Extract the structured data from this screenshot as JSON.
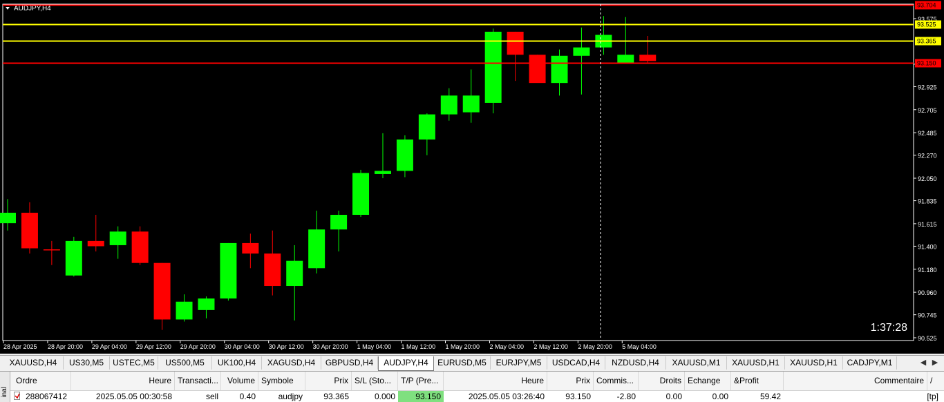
{
  "chart": {
    "symbol_label": "AUDJPY,H4",
    "countdown": "1:37:28",
    "price_axis": [
      "93.575",
      "93.140",
      "92.925",
      "92.705",
      "92.485",
      "92.270",
      "92.050",
      "91.835",
      "91.615",
      "91.400",
      "91.180",
      "90.960",
      "90.745",
      "90.525"
    ],
    "time_axis": [
      "28 Apr 2025",
      "28 Apr 20:00",
      "29 Apr 04:00",
      "29 Apr 12:00",
      "29 Apr 20:00",
      "30 Apr 04:00",
      "30 Apr 12:00",
      "30 Apr 20:00",
      "1 May 04:00",
      "1 May 12:00",
      "1 May 20:00",
      "2 May 04:00",
      "2 May 12:00",
      "2 May 20:00",
      "5 May 04:00"
    ],
    "levels": [
      {
        "price": "93.704",
        "color": "#ff0000"
      },
      {
        "price": "93.525",
        "color": "#ffff00"
      },
      {
        "price": "93.365",
        "color": "#ffff00"
      },
      {
        "price": "93.150",
        "color": "#ff0000"
      }
    ],
    "bull_color": "#00ff00",
    "bear_color": "#ff0000"
  },
  "chart_data": {
    "type": "candlestick",
    "title": "AUDJPY,H4",
    "ylim": [
      90.525,
      93.704
    ],
    "candles": [
      {
        "o": 91.62,
        "h": 91.85,
        "l": 91.55,
        "c": 91.72
      },
      {
        "o": 91.72,
        "h": 91.82,
        "l": 91.33,
        "c": 91.38
      },
      {
        "o": 91.37,
        "h": 91.45,
        "l": 91.22,
        "c": 91.36
      },
      {
        "o": 91.12,
        "h": 91.49,
        "l": 91.11,
        "c": 91.45
      },
      {
        "o": 91.45,
        "h": 91.7,
        "l": 91.35,
        "c": 91.4
      },
      {
        "o": 91.41,
        "h": 91.59,
        "l": 91.28,
        "c": 91.54
      },
      {
        "o": 91.54,
        "h": 91.59,
        "l": 91.22,
        "c": 91.24
      },
      {
        "o": 91.24,
        "h": 91.24,
        "l": 90.6,
        "c": 90.7
      },
      {
        "o": 90.7,
        "h": 90.94,
        "l": 90.68,
        "c": 90.87
      },
      {
        "o": 90.79,
        "h": 90.92,
        "l": 90.71,
        "c": 90.9
      },
      {
        "o": 90.9,
        "h": 91.43,
        "l": 90.88,
        "c": 91.43
      },
      {
        "o": 91.43,
        "h": 91.52,
        "l": 91.19,
        "c": 91.33
      },
      {
        "o": 91.33,
        "h": 91.55,
        "l": 90.93,
        "c": 91.02
      },
      {
        "o": 91.02,
        "h": 91.41,
        "l": 90.69,
        "c": 91.26
      },
      {
        "o": 91.19,
        "h": 91.74,
        "l": 91.14,
        "c": 91.56
      },
      {
        "o": 91.56,
        "h": 91.74,
        "l": 91.35,
        "c": 91.7
      },
      {
        "o": 91.7,
        "h": 92.13,
        "l": 91.68,
        "c": 92.1
      },
      {
        "o": 92.09,
        "h": 92.48,
        "l": 92.05,
        "c": 92.12
      },
      {
        "o": 92.12,
        "h": 92.46,
        "l": 92.06,
        "c": 92.42
      },
      {
        "o": 92.42,
        "h": 92.67,
        "l": 92.27,
        "c": 92.66
      },
      {
        "o": 92.66,
        "h": 92.91,
        "l": 92.6,
        "c": 92.84
      },
      {
        "o": 92.68,
        "h": 93.09,
        "l": 92.58,
        "c": 92.84
      },
      {
        "o": 92.77,
        "h": 93.48,
        "l": 92.67,
        "c": 93.45
      },
      {
        "o": 93.45,
        "h": 93.45,
        "l": 92.98,
        "c": 93.23
      },
      {
        "o": 93.23,
        "h": 93.23,
        "l": 92.97,
        "c": 92.96
      },
      {
        "o": 92.96,
        "h": 93.28,
        "l": 92.84,
        "c": 93.22
      },
      {
        "o": 93.22,
        "h": 93.49,
        "l": 92.85,
        "c": 93.3
      },
      {
        "o": 93.3,
        "h": 93.6,
        "l": 93.23,
        "c": 93.42
      },
      {
        "o": 93.15,
        "h": 93.59,
        "l": 93.15,
        "c": 93.23
      },
      {
        "o": 93.23,
        "h": 93.41,
        "l": 93.15,
        "c": 93.17
      }
    ]
  },
  "tabs": [
    {
      "label": "XAUUSD,H4",
      "active": false
    },
    {
      "label": "US30,M5",
      "active": false
    },
    {
      "label": "USTEC,M5",
      "active": false
    },
    {
      "label": "US500,M5",
      "active": false
    },
    {
      "label": "UK100,H4",
      "active": false
    },
    {
      "label": "XAGUSD,H4",
      "active": false
    },
    {
      "label": "GBPUSD,H4",
      "active": false
    },
    {
      "label": "AUDJPY,H4",
      "active": true
    },
    {
      "label": "EURUSD,M5",
      "active": false
    },
    {
      "label": "EURJPY,M5",
      "active": false
    },
    {
      "label": "USDCAD,H4",
      "active": false
    },
    {
      "label": "NZDUSD,H4",
      "active": false
    },
    {
      "label": "XAUUSD,M1",
      "active": false
    },
    {
      "label": "XAUUSD,H1",
      "active": false
    },
    {
      "label": "XAUUSD,H1",
      "active": false
    },
    {
      "label": "CADJPY,M1",
      "active": false
    }
  ],
  "tab_scroll_left": "◀",
  "tab_scroll_right": "▶",
  "terminal": {
    "side_label": "inal",
    "headers": [
      "Ordre",
      "Heure",
      "Transacti...",
      "Volume",
      "Symbole",
      "Prix",
      "S/L (Sto...",
      "T/P (Pre...",
      "Heure",
      "Prix",
      "Commis...",
      "Droits",
      "Echange",
      "&Profit",
      "Commentaire"
    ],
    "sort_indicator": "/",
    "row": [
      "288067412",
      "2025.05.05 00:30:58",
      "sell",
      "0.40",
      "audjpy",
      "93.365",
      "0.000",
      "93.150",
      "2025.05.05 03:26:40",
      "93.150",
      "-2.80",
      "0.00",
      "0.00",
      "59.42",
      "[tp]"
    ]
  }
}
